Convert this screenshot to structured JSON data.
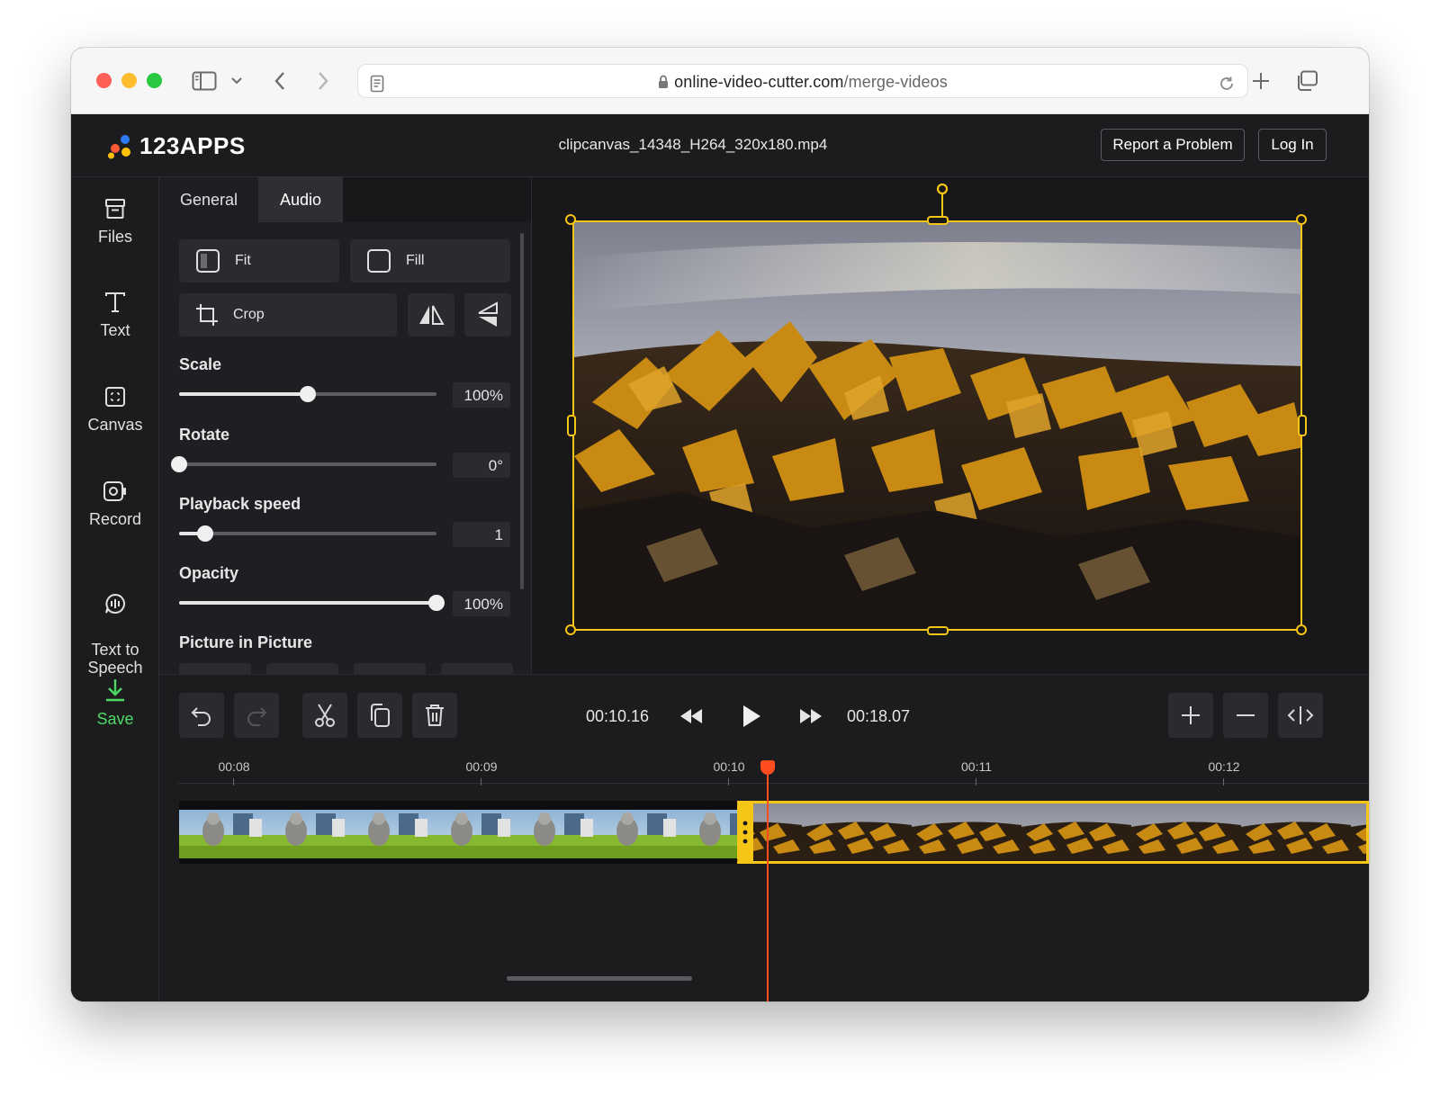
{
  "browser": {
    "url_domain": "online-video-cutter.com",
    "url_path": "/merge-videos"
  },
  "header": {
    "logo_text": "123APPS",
    "filename": "clipcanvas_14348_H264_320x180.mp4",
    "report_label": "Report a Problem",
    "login_label": "Log In"
  },
  "sidebar": {
    "items": [
      {
        "label": "Files"
      },
      {
        "label": "Text"
      },
      {
        "label": "Canvas"
      },
      {
        "label": "Record"
      },
      {
        "label": "Text to\nSpeech"
      },
      {
        "label": "Save"
      }
    ]
  },
  "panel": {
    "tabs": [
      "General",
      "Audio"
    ],
    "fit_label": "Fit",
    "fill_label": "Fill",
    "crop_label": "Crop",
    "scale": {
      "label": "Scale",
      "value": "100%",
      "fraction": 0.5
    },
    "rotate": {
      "label": "Rotate",
      "value": "0°",
      "fraction": 0.0
    },
    "speed": {
      "label": "Playback speed",
      "value": "1",
      "fraction": 0.1
    },
    "opacity": {
      "label": "Opacity",
      "value": "100%",
      "fraction": 1.0
    },
    "pip_label": "Picture in Picture"
  },
  "timeline": {
    "current_time": "00:10.16",
    "total_time": "00:18.07",
    "ruler": [
      "00:08",
      "00:09",
      "00:10",
      "00:11",
      "00:12"
    ]
  },
  "colors": {
    "accent": "#f5c518",
    "playhead": "#ff4d1f",
    "save": "#4cd964"
  }
}
